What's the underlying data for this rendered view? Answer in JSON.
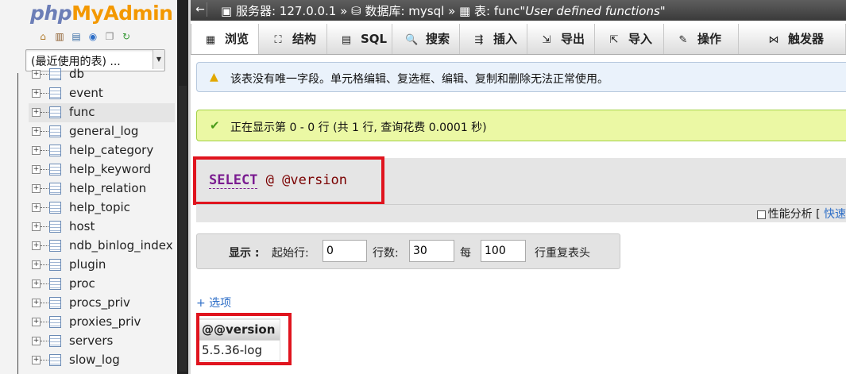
{
  "app": {
    "logo_php": "php",
    "logo_my": "My",
    "logo_admin": "Admin"
  },
  "nav": {
    "icons": [
      "home-icon",
      "table-icon",
      "docs-icon",
      "help-icon",
      "copy-icon",
      "reload-icon"
    ],
    "recent_select": "(最近使用的表) ...",
    "tables": [
      {
        "name": "db",
        "selected": false
      },
      {
        "name": "event",
        "selected": false
      },
      {
        "name": "func",
        "selected": true
      },
      {
        "name": "general_log",
        "selected": false
      },
      {
        "name": "help_category",
        "selected": false
      },
      {
        "name": "help_keyword",
        "selected": false
      },
      {
        "name": "help_relation",
        "selected": false
      },
      {
        "name": "help_topic",
        "selected": false
      },
      {
        "name": "host",
        "selected": false
      },
      {
        "name": "ndb_binlog_index",
        "selected": false
      },
      {
        "name": "plugin",
        "selected": false
      },
      {
        "name": "proc",
        "selected": false
      },
      {
        "name": "procs_priv",
        "selected": false
      },
      {
        "name": "proxies_priv",
        "selected": false
      },
      {
        "name": "servers",
        "selected": false
      },
      {
        "name": "slow_log",
        "selected": false
      }
    ]
  },
  "breadcrumb": {
    "server": "服务器: 127.0.0.1",
    "sep1": "»",
    "database": "数据库: mysql",
    "sep2": "»",
    "table": "表: func",
    "comment": "\"User defined functions\""
  },
  "tabs": [
    {
      "label": "浏览",
      "icon": "browse-icon",
      "glyph": "▦",
      "active": true
    },
    {
      "label": "结构",
      "icon": "structure-icon",
      "glyph": "⛶",
      "active": false
    },
    {
      "label": "SQL",
      "icon": "sql-icon",
      "glyph": "▤",
      "active": false
    },
    {
      "label": "搜索",
      "icon": "search-icon",
      "glyph": "🔍",
      "active": false
    },
    {
      "label": "插入",
      "icon": "insert-icon",
      "glyph": "⇶",
      "active": false
    },
    {
      "label": "导出",
      "icon": "export-icon",
      "glyph": "⇲",
      "active": false
    },
    {
      "label": "导入",
      "icon": "import-icon",
      "glyph": "⇱",
      "active": false
    },
    {
      "label": "操作",
      "icon": "wrench-icon",
      "glyph": "✎",
      "active": false
    },
    {
      "label": "触发器",
      "icon": "trigger-icon",
      "glyph": "⋈",
      "active": false
    }
  ],
  "notice": {
    "text": "该表没有唯一字段。单元格编辑、复选框、编辑、复制和删除无法正常使用。"
  },
  "success": {
    "text": "正在显示第 0 - 0 行 (共 1 行, 查询花费 0.0001 秒)"
  },
  "sql": {
    "keyword": "SELECT",
    "expr": " @ @version"
  },
  "sql_options": {
    "profiling": "性能分析",
    "bracket": "[",
    "quick_edit": "快速"
  },
  "display_form": {
    "title": "显示 :",
    "start_label": "起始行:",
    "start_value": "0",
    "rows_label": "行数:",
    "rows_value": "30",
    "every_label": "每",
    "every_value": "100",
    "repeat_label": "行重复表头"
  },
  "options_link": "+ 选项",
  "result": {
    "columns": [
      "@@version"
    ],
    "rows": [
      [
        "5.5.36-log"
      ]
    ]
  }
}
